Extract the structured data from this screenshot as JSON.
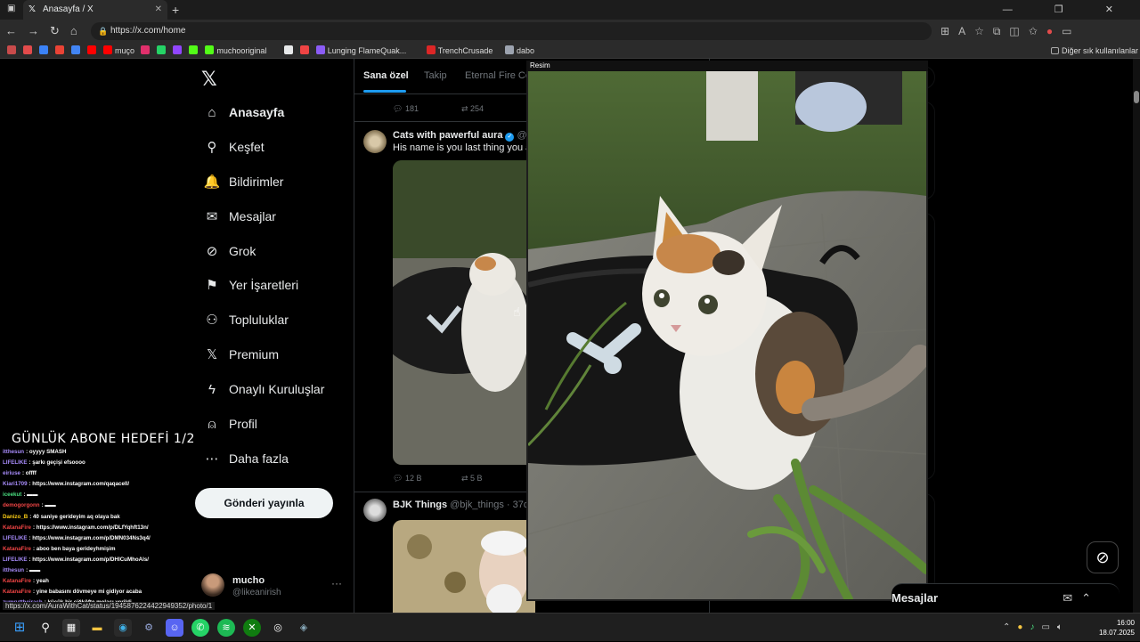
{
  "browser": {
    "tab_title": "Anasayfa / X",
    "tab_close": "✕",
    "new_tab": "+",
    "url": "https://x.com/home",
    "window_controls": "— ❐ ✕"
  },
  "bookmarks": [
    {
      "label": "",
      "color": "#c94b4b"
    },
    {
      "label": "",
      "color": "#e24b4b"
    },
    {
      "label": "",
      "color": "#3b82f6"
    },
    {
      "label": "",
      "color": "#ea4335"
    },
    {
      "label": "",
      "color": "#4285f4"
    },
    {
      "label": "",
      "color": "#ff0000"
    },
    {
      "label": "muço",
      "color": "#ff0000"
    },
    {
      "label": "",
      "color": "#e1306c"
    },
    {
      "label": "",
      "color": "#25d366"
    },
    {
      "label": "",
      "color": "#9146ff"
    },
    {
      "label": "",
      "color": "#53fc18"
    },
    {
      "label": "muchooriginal",
      "color": "#53fc18"
    },
    {
      "label": "",
      "color": "#e7e9ea"
    },
    {
      "label": "",
      "color": "#ef4444"
    },
    {
      "label": "Lunging FlameQuak...",
      "color": "#8b5cf6"
    },
    {
      "label": "TrenchCrusade",
      "color": "#dc2626"
    },
    {
      "label": "dabo",
      "color": "#9ca3af"
    }
  ],
  "bookmarks_other": "Diğer sık kullanılanlar",
  "sidebar": {
    "items": [
      {
        "label": "Anasayfa",
        "icon": "⌂"
      },
      {
        "label": "Keşfet",
        "icon": "⚲"
      },
      {
        "label": "Bildirimler",
        "icon": "🔔"
      },
      {
        "label": "Mesajlar",
        "icon": "✉"
      },
      {
        "label": "Grok",
        "icon": "⊘"
      },
      {
        "label": "Yer İşaretleri",
        "icon": "⚑"
      },
      {
        "label": "Topluluklar",
        "icon": "⚇"
      },
      {
        "label": "Premium",
        "icon": "𝕏"
      },
      {
        "label": "Onaylı Kuruluşlar",
        "icon": "ϟ"
      },
      {
        "label": "Profil",
        "icon": "⍝"
      },
      {
        "label": "Daha fazla",
        "icon": "⋯"
      }
    ],
    "post_button": "Gönderi yayınla",
    "account_name": "mucho",
    "account_handle": "@likeanirish",
    "account_more": "···"
  },
  "overlay": {
    "goal": "GÜNLÜK ABONE HEDEFİ 1/2",
    "chat": [
      {
        "user": "itthesun",
        "color": "#a78bfa",
        "msg": ": oyyyy SMASH"
      },
      {
        "user": "LIFELIKE",
        "color": "#a78bfa",
        "msg": ": şarkı geçişi efsoooo"
      },
      {
        "user": "eiriuse",
        "color": "#a78bfa",
        "msg": ": offff"
      },
      {
        "user": "Kiari1709",
        "color": "#a78bfa",
        "msg": ": https://www.instagram.com/qaqacell/"
      },
      {
        "user": "iceekut",
        "color": "#4ade80",
        "msg": ": ▬▬"
      },
      {
        "user": "demogorgonn",
        "color": "#ef4444",
        "msg": ": ▬▬"
      },
      {
        "user": "Danizo_B",
        "color": "#facc15",
        "msg": ": 40 saniye gerideyim aq olaya bak"
      },
      {
        "user": "KatanaFire",
        "color": "#ef4444",
        "msg": ": https://www.instagram.com/p/DLfYqhft13n/"
      },
      {
        "user": "LIFELIKE",
        "color": "#a78bfa",
        "msg": ": https://www.instagram.com/p/DMN034Ns3q4/"
      },
      {
        "user": "KatanaFire",
        "color": "#ef4444",
        "msg": ": aboo ben baya gerideyhmişim"
      },
      {
        "user": "LIFELIKE",
        "color": "#a78bfa",
        "msg": ": https://www.instagram.com/p/DHICuMhoAls/"
      },
      {
        "user": "itthesun",
        "color": "#a78bfa",
        "msg": ": ▬▬"
      },
      {
        "user": "KatanaFire",
        "color": "#ef4444",
        "msg": ": yeah"
      },
      {
        "user": "KatanaFire",
        "color": "#ef4444",
        "msg": ": yine babasını dövmeye mi gidiyor acaba"
      },
      {
        "user": "zumruttheirash",
        "color": "#a78bfa",
        "msg": ": küçük bir çiğköfte molası verildi"
      }
    ],
    "status_url": "https://x.com/AuraWithCat/status/1945876224422949352/photo/1"
  },
  "feed": {
    "tabs": [
      "Sana özel",
      "Takip",
      "Eternal Fire Co"
    ],
    "prev_stats": {
      "replies": "181",
      "reposts": "254"
    },
    "post1": {
      "name": "Cats with pawerful aura",
      "verified": "✓",
      "handle": "@Au",
      "text": "His name is you last thing you ate",
      "replies": "12 B",
      "reposts": "5 B"
    },
    "post2": {
      "name": "BJK Things",
      "handle": "@bjk_things · 37d"
    }
  },
  "lightbox": {
    "header": "Resim"
  },
  "messages_dock": {
    "title": "Mesajlar"
  },
  "taskbar": {
    "time": "16:00",
    "date": "18.07.2025"
  }
}
